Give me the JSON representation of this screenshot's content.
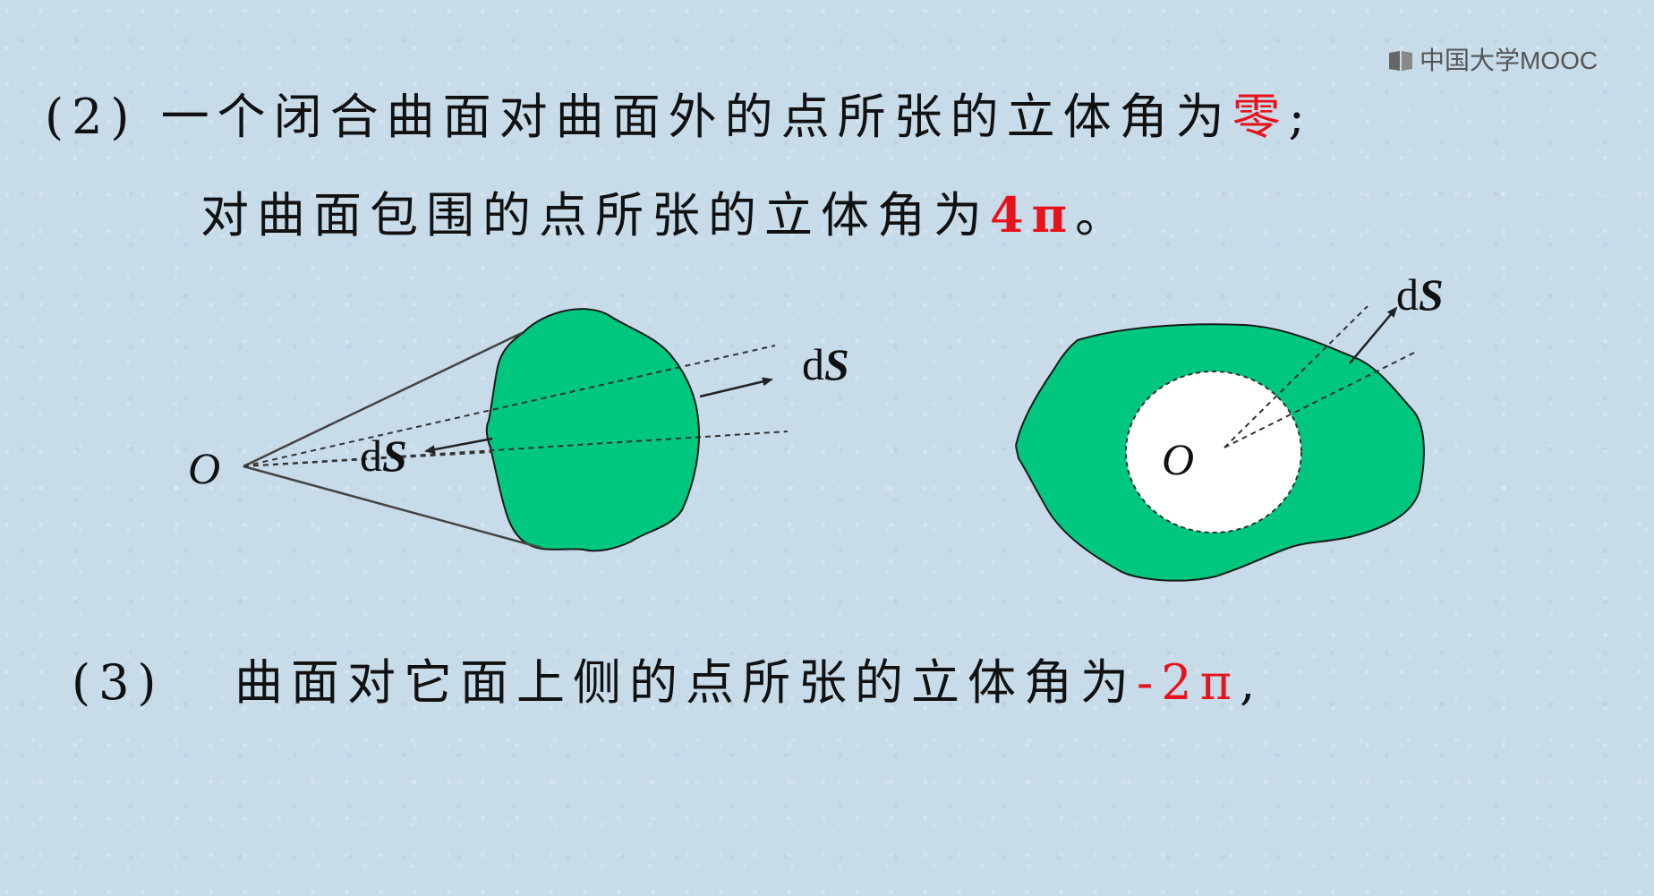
{
  "watermark": "中国大学MOOC",
  "line1": {
    "number": "(2)",
    "text": "一个闭合曲面对曲面外的点所张的立体角为",
    "highlight": "零",
    "end": ";"
  },
  "line2": {
    "text": "对曲面包围的点所张的立体角为",
    "highlight": "4π",
    "end": "。"
  },
  "line3": {
    "number": "(3)",
    "text": "曲面对它面上侧的点所张的立体角为",
    "highlight": "-2π",
    "end": ","
  },
  "figure_left": {
    "origin": "O",
    "ds_outer": {
      "d": "d",
      "s": "S"
    },
    "ds_inner": {
      "d": "d",
      "s": "S"
    }
  },
  "figure_right": {
    "origin": "O",
    "ds": {
      "d": "d",
      "s": "S"
    }
  },
  "colors": {
    "surface": "#00c77f",
    "highlight": "#e8121a",
    "background": "#c7dbe9"
  }
}
